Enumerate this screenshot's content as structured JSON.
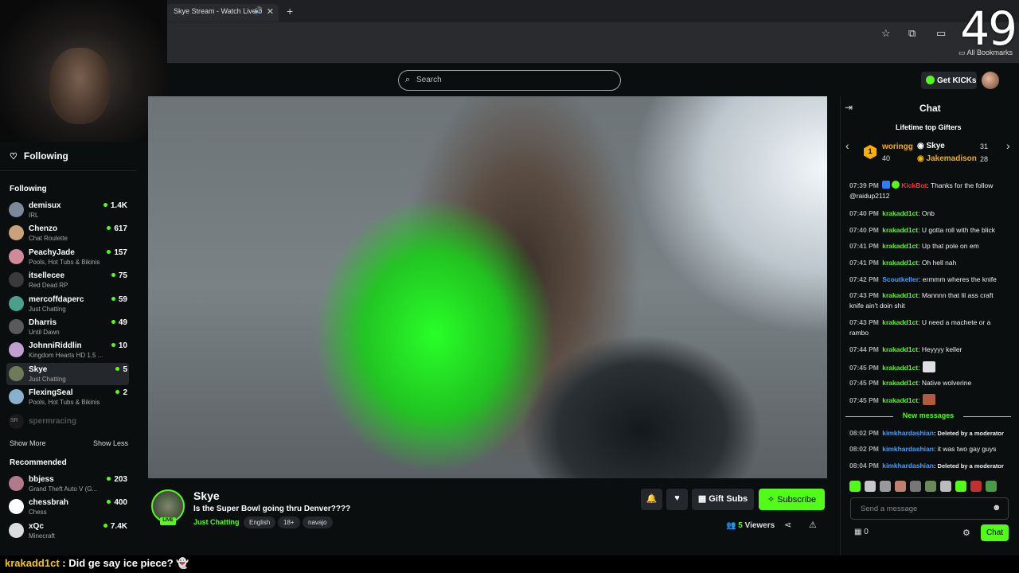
{
  "browser": {
    "tab_title": "Skye Stream - Watch Live o",
    "tab_close": "✕",
    "new_tab": "+",
    "bookmarks_label": "All Bookmarks",
    "overlay_counter": "49"
  },
  "nav": {
    "search_placeholder": "Search",
    "get_kicks": "Get KICKs"
  },
  "sidebar": {
    "following_nav": "Following",
    "following_header": "Following",
    "following": [
      {
        "name": "demisux",
        "category": "IRL",
        "viewers": "1.4K",
        "color": "#7b8a99"
      },
      {
        "name": "Chenzo",
        "category": "Chat Roulette",
        "viewers": "617",
        "color": "#c9a27a"
      },
      {
        "name": "PeachyJade",
        "category": "Pools, Hot Tubs & Bikinis",
        "viewers": "157",
        "color": "#d08a9a"
      },
      {
        "name": "itsellecee",
        "category": "Red Dead RP",
        "viewers": "75",
        "color": "#3a3a3a"
      },
      {
        "name": "mercoffdaperc",
        "category": "Just Chatting",
        "viewers": "59",
        "color": "#4aa08a"
      },
      {
        "name": "Dharris",
        "category": "Until Dawn",
        "viewers": "49",
        "color": "#5a5a5a"
      },
      {
        "name": "JohnniRiddlin",
        "category": "Kingdom Hearts HD 1.5 ...",
        "viewers": "10",
        "color": "#c0a0d0"
      },
      {
        "name": "Skye",
        "category": "Just Chatting",
        "viewers": "5",
        "color": "#6f7a5a"
      },
      {
        "name": "FlexingSeal",
        "category": "Pools, Hot Tubs & Bikinis",
        "viewers": "2",
        "color": "#8ab0d0"
      }
    ],
    "offline_name": "spermracing",
    "show_more": "Show More",
    "show_less": "Show Less",
    "recommended_header": "Recommended",
    "recommended": [
      {
        "name": "bbjess",
        "category": "Grand Theft Auto V (G...",
        "viewers": "203",
        "color": "#b07a8a"
      },
      {
        "name": "chessbrah",
        "category": "Chess",
        "viewers": "400",
        "color": "#ffffff"
      },
      {
        "name": "xQc",
        "category": "Minecraft",
        "viewers": "7.4K",
        "color": "#dddddd"
      }
    ]
  },
  "stream": {
    "streamer": "Skye",
    "live": "LIVE",
    "title": "Is the Super Bowl going thru Denver????",
    "category": "Just Chatting",
    "tags": [
      "English",
      "18+",
      "navajo"
    ],
    "gift_subs": "Gift Subs",
    "subscribe": "Subscribe",
    "viewers_count": "5",
    "viewers_label": "Viewers"
  },
  "chat": {
    "title": "Chat",
    "gifters_title": "Lifetime top Gifters",
    "gifters": [
      {
        "rank": "1",
        "name": "woringg",
        "count": "40"
      },
      {
        "name": "Skye",
        "count": "31"
      },
      {
        "name": "Jakemadison",
        "count": "28"
      }
    ],
    "messages": [
      {
        "time": "07:39 PM",
        "user": "KickBot",
        "text": ": Thanks for the follow @raidup2112"
      },
      {
        "time": "07:40 PM",
        "user": "krakadd1ct",
        "text": ": Onb"
      },
      {
        "time": "07:40 PM",
        "user": "krakadd1ct",
        "text": ": U gotta roll with the blick"
      },
      {
        "time": "07:41 PM",
        "user": "krakadd1ct",
        "text": ": Up that pole on em"
      },
      {
        "time": "07:41 PM",
        "user": "krakadd1ct",
        "text": ": Oh hell nah"
      },
      {
        "time": "07:42 PM",
        "user": "Scoutkeller",
        "text": ": ermmm wheres the knife"
      },
      {
        "time": "07:43 PM",
        "user": "krakadd1ct",
        "text": ": Mannnn that lil ass craft knife ain't doin shit"
      },
      {
        "time": "07:43 PM",
        "user": "krakadd1ct",
        "text": ": U need a machete or a rambo"
      },
      {
        "time": "07:44 PM",
        "user": "krakadd1ct",
        "text": ": Heyyyy keller"
      },
      {
        "time": "07:45 PM",
        "user": "krakadd1ct",
        "text": ":"
      },
      {
        "time": "07:45 PM",
        "user": "krakadd1ct",
        "text": ": Native wolverine"
      },
      {
        "time": "07:45 PM",
        "user": "krakadd1ct",
        "text": ":"
      }
    ],
    "new_messages": "New messages",
    "new": [
      {
        "time": "08:02 PM",
        "user": "kimkhardashian",
        "text": ": Deleted by a moderator"
      },
      {
        "time": "08:02 PM",
        "user": "kimkhardashian",
        "text": ": it was two gay guys"
      },
      {
        "time": "08:04 PM",
        "user": "kimkhardashian",
        "text": ": Deleted by a moderator"
      }
    ],
    "input_placeholder": "Send a message",
    "gift_count": "0",
    "send": "Chat"
  },
  "ticker": {
    "user": "krakadd1ct",
    "text": " : Did ge say ice piece?"
  },
  "colors": {
    "accent": "#53fc18",
    "bg": "#0b0e0f",
    "panel": "#24272c"
  }
}
